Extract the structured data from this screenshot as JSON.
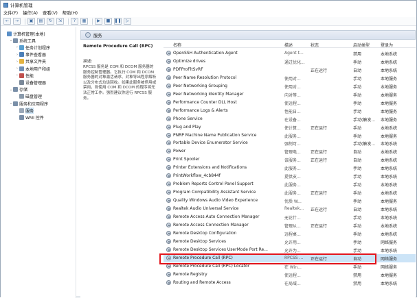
{
  "window_title": "计算机管理",
  "menu": [
    "文件(F)",
    "操作(A)",
    "查看(V)",
    "帮助(H)"
  ],
  "toolbar_icons": [
    "back-arrow-icon",
    "forward-arrow-icon",
    "up-folder-icon",
    "console-tree-icon",
    "refresh-icon",
    "export-icon",
    "help-icon",
    "properties-icon",
    "play-icon",
    "stop-icon",
    "pause-icon",
    "restart-icon"
  ],
  "tree": [
    {
      "label": "计算机管理(本地)",
      "level": 0,
      "expander": "",
      "icon_color": "#5a8fc7"
    },
    {
      "label": "系统工具",
      "level": 1,
      "expander": "⌄",
      "icon_color": "#7a8fa8"
    },
    {
      "label": "任务计划程序",
      "level": 2,
      "expander": "›",
      "icon_color": "#5aa0d0"
    },
    {
      "label": "事件查看器",
      "level": 2,
      "expander": "›",
      "icon_color": "#4c7fb8"
    },
    {
      "label": "共享文件夹",
      "level": 2,
      "expander": "›",
      "icon_color": "#e3b341"
    },
    {
      "label": "本地用户和组",
      "level": 2,
      "expander": "›",
      "icon_color": "#6f8fb5"
    },
    {
      "label": "性能",
      "level": 2,
      "expander": "›",
      "icon_color": "#c0504d"
    },
    {
      "label": "设备管理器",
      "level": 2,
      "expander": "",
      "icon_color": "#7a8898"
    },
    {
      "label": "存储",
      "level": 1,
      "expander": "⌄",
      "icon_color": "#7a8fa8"
    },
    {
      "label": "磁盘管理",
      "level": 2,
      "expander": "",
      "icon_color": "#8a9aab"
    },
    {
      "label": "服务和应用程序",
      "level": 1,
      "expander": "⌄",
      "icon_color": "#7a8fa8"
    },
    {
      "label": "服务",
      "level": 2,
      "expander": "",
      "icon_color": "#9aa8b8",
      "selected": true
    },
    {
      "label": "WMI 控件",
      "level": 2,
      "expander": "",
      "icon_color": "#7a8fa8"
    }
  ],
  "header_title": "服务",
  "desc": {
    "name": "Remote Procedure Call (RPC)",
    "label": "描述:",
    "text": "RPCSS 服务是 COM 和 DCOM 服务器的服务控制管理器。它执行 COM 和 DCOM 服务器的对象激活请求、对象导出程序解析以及分布式垃圾回收。如果此服务被停用或禁用，则使用 COM 和 DCOM 的程序将无法正常工作。强烈建议你运行 RPCSS 服务。"
  },
  "columns": {
    "name": "名称",
    "desc": "描述",
    "status": "状态",
    "startup": "启动类型",
    "logon": "登录为"
  },
  "rows": [
    {
      "name": "OpenSSH Authentication Agent",
      "desc": "Agent t...",
      "status": "",
      "startup": "禁用",
      "logon": "本地系统"
    },
    {
      "name": "Optimize drives",
      "desc": "通过优化...",
      "status": "",
      "startup": "手动",
      "logon": "本地系统"
    },
    {
      "name": "PDFProFltSvRF",
      "desc": "",
      "status": "正在运行",
      "startup": "自动",
      "logon": "本地系统"
    },
    {
      "name": "Peer Name Resolution Protocol",
      "desc": "使用对...",
      "status": "",
      "startup": "手动",
      "logon": "本地服务"
    },
    {
      "name": "Peer Networking Grouping",
      "desc": "使用对...",
      "status": "",
      "startup": "手动",
      "logon": "本地服务"
    },
    {
      "name": "Peer Networking Identity Manager",
      "desc": "向对等...",
      "status": "",
      "startup": "手动",
      "logon": "本地服务"
    },
    {
      "name": "Performance Counter DLL Host",
      "desc": "使远程...",
      "status": "",
      "startup": "手动",
      "logon": "本地服务"
    },
    {
      "name": "Performance Logs & Alerts",
      "desc": "性能日...",
      "status": "",
      "startup": "手动",
      "logon": "本地服务"
    },
    {
      "name": "Phone Service",
      "desc": "在设备...",
      "status": "",
      "startup": "手动(触发...",
      "logon": "本地服务"
    },
    {
      "name": "Plug and Play",
      "desc": "使计算...",
      "status": "正在运行",
      "startup": "手动",
      "logon": "本地系统"
    },
    {
      "name": "PNRP Machine Name Publication Service",
      "desc": "此服务...",
      "status": "",
      "startup": "手动",
      "logon": "本地服务"
    },
    {
      "name": "Portable Device Enumerator Service",
      "desc": "强制可...",
      "status": "",
      "startup": "手动(触发...",
      "logon": "本地系统"
    },
    {
      "name": "Power",
      "desc": "管理电...",
      "status": "正在运行",
      "startup": "自动",
      "logon": "本地系统"
    },
    {
      "name": "Print Spooler",
      "desc": "该服务...",
      "status": "正在运行",
      "startup": "自动",
      "logon": "本地系统"
    },
    {
      "name": "Printer Extensions and Notifications",
      "desc": "此服务...",
      "status": "",
      "startup": "手动",
      "logon": "本地系统"
    },
    {
      "name": "PrintWorkflow_4cb844f",
      "desc": "提供支...",
      "status": "",
      "startup": "手动",
      "logon": "本地系统"
    },
    {
      "name": "Problem Reports Control Panel Support",
      "desc": "此服务...",
      "status": "",
      "startup": "手动",
      "logon": "本地系统"
    },
    {
      "name": "Program Compatibility Assistant Service",
      "desc": "此服务...",
      "status": "正在运行",
      "startup": "手动",
      "logon": "本地系统"
    },
    {
      "name": "Quality Windows Audio Video Experience",
      "desc": "优质 W...",
      "status": "",
      "startup": "手动",
      "logon": "本地服务"
    },
    {
      "name": "Realtek Audio Universal Service",
      "desc": "Realtek...",
      "status": "正在运行",
      "startup": "自动",
      "logon": "本地系统"
    },
    {
      "name": "Remote Access Auto Connection Manager",
      "desc": "无论什...",
      "status": "",
      "startup": "手动",
      "logon": "本地系统"
    },
    {
      "name": "Remote Access Connection Manager",
      "desc": "管理从...",
      "status": "正在运行",
      "startup": "手动",
      "logon": "本地系统"
    },
    {
      "name": "Remote Desktop Configuration",
      "desc": "远程桌...",
      "status": "",
      "startup": "手动",
      "logon": "本地系统"
    },
    {
      "name": "Remote Desktop Services",
      "desc": "允许用...",
      "status": "",
      "startup": "手动",
      "logon": "网络服务"
    },
    {
      "name": "Remote Desktop Services UserMode Port Re...",
      "desc": "允许为...",
      "status": "",
      "startup": "手动",
      "logon": "本地系统"
    },
    {
      "name": "Remote Procedure Call (RPC)",
      "desc": "RPCSS ...",
      "status": "正在运行",
      "startup": "自动",
      "logon": "网络服务",
      "selected": true
    },
    {
      "name": "Remote Procedure Call (RPC) Locator",
      "desc": "在 Win...",
      "status": "",
      "startup": "手动",
      "logon": "网络服务"
    },
    {
      "name": "Remote Registry",
      "desc": "使远程...",
      "status": "",
      "startup": "禁用",
      "logon": "本地服务"
    },
    {
      "name": "Routing and Remote Access",
      "desc": "在局域...",
      "status": "",
      "startup": "禁用",
      "logon": "本地系统"
    }
  ],
  "colors": {
    "selection": "#cce4f7",
    "highlight_box": "#e3141c",
    "header_bg": "#e9eef6"
  }
}
